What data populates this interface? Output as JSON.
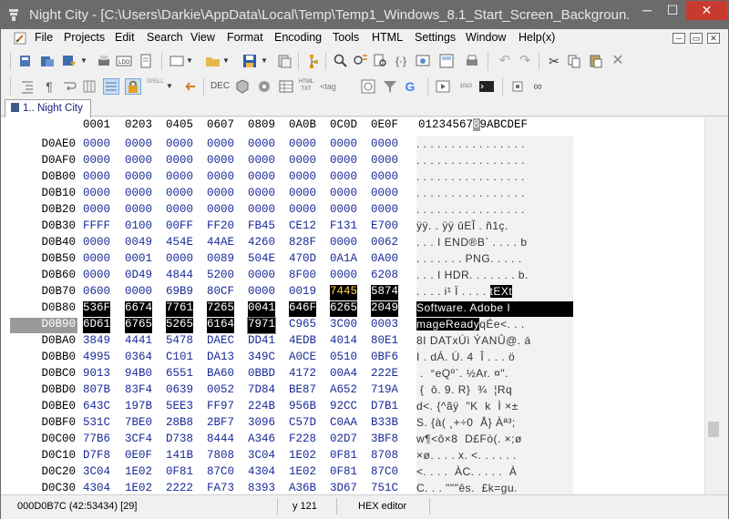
{
  "window": {
    "title": "Night City - [C:\\Users\\Darkie\\AppData\\Local\\Temp\\Temp1_Windows_8.1_Start_Screen_Backgroun...",
    "minimize": "─",
    "maximize": "☐",
    "close": "✕"
  },
  "menu": {
    "items": [
      "File",
      "Projects",
      "Edit",
      "Search",
      "View",
      "Format",
      "Encoding",
      "Tools",
      "HTML",
      "Settings",
      "Window",
      "Help(x)"
    ],
    "mdi_minimize": "─",
    "mdi_restore": "▭",
    "mdi_close": "✕"
  },
  "toolbar1": {
    "icons": [
      "new-project-icon",
      "open-project-icon",
      "save-project-icon",
      "print-icon",
      "ldd-icon",
      "page-icon",
      "new-file-icon",
      "open-folder-icon",
      "save-icon",
      "save-all-icon",
      "tree-icon",
      "find-icon",
      "replace-icon",
      "find-in-files-icon",
      "brackets-icon",
      "preview-icon",
      "print-doc-icon",
      "undo-icon",
      "redo-icon",
      "cut-icon",
      "copy-icon",
      "paste-icon",
      "delete-icon"
    ]
  },
  "toolbar2": {
    "icons": [
      "indent-icon",
      "pilcrow-icon",
      "wrap-icon",
      "column-mode-icon",
      "lock-icon",
      "spell-icon",
      "arrow-icon",
      "dec-icon",
      "cube-icon",
      "wheel-icon",
      "table-icon",
      "html-txt-icon",
      "tag-icon",
      "link-icon",
      "grid-icon",
      "filter-icon",
      "google-icon",
      "play-icon",
      "binary-icon",
      "cmd-icon",
      "stop-icon",
      "glasses-icon"
    ],
    "spell_label": "SPELL",
    "html_label": "HTML",
    "txt_label": "TXT",
    "bin_label": "1010",
    "tag_label": "<tag"
  },
  "tab": {
    "label": "1.. Night City"
  },
  "hex": {
    "header_cols": [
      "0001",
      "0203",
      "0405",
      "0607",
      "0809",
      "0A0B",
      "0C0D",
      "0E0F"
    ],
    "header_ascii_pre": "01234567",
    "header_ascii_caret": "8",
    "header_ascii_post": "9ABCDEF",
    "rows": [
      {
        "addr": "D0AE0",
        "cells": [
          "0000",
          "0000",
          "0000",
          "0000",
          "0000",
          "0000",
          "0000",
          "0000"
        ],
        "ascii": ". . . . . . . . . . . . . . . ."
      },
      {
        "addr": "D0AF0",
        "cells": [
          "0000",
          "0000",
          "0000",
          "0000",
          "0000",
          "0000",
          "0000",
          "0000"
        ],
        "ascii": ". . . . . . . . . . . . . . . ."
      },
      {
        "addr": "D0B00",
        "cells": [
          "0000",
          "0000",
          "0000",
          "0000",
          "0000",
          "0000",
          "0000",
          "0000"
        ],
        "ascii": ". . . . . . . . . . . . . . . ."
      },
      {
        "addr": "D0B10",
        "cells": [
          "0000",
          "0000",
          "0000",
          "0000",
          "0000",
          "0000",
          "0000",
          "0000"
        ],
        "ascii": ". . . . . . . . . . . . . . . ."
      },
      {
        "addr": "D0B20",
        "cells": [
          "0000",
          "0000",
          "0000",
          "0000",
          "0000",
          "0000",
          "0000",
          "0000"
        ],
        "ascii": ". . . . . . . . . . . . . . . ."
      },
      {
        "addr": "D0B30",
        "cells": [
          "FFFF",
          "0100",
          "00FF",
          "FF20",
          "FB45",
          "CE12",
          "F131",
          "E700"
        ],
        "ascii": "ÿÿ. . ÿÿ ûEÎ . ñ1ç."
      },
      {
        "addr": "D0B40",
        "cells": [
          "0000",
          "0049",
          "454E",
          "44AE",
          "4260",
          "828F",
          "0000",
          "0062"
        ],
        "ascii": ". . . I END®B` . . . . b"
      },
      {
        "addr": "D0B50",
        "cells": [
          "0000",
          "0001",
          "0000",
          "0089",
          "504E",
          "470D",
          "0A1A",
          "0A00"
        ],
        "ascii": ". . . . . . . PNG. . . . ."
      },
      {
        "addr": "D0B60",
        "cells": [
          "0000",
          "0D49",
          "4844",
          "5200",
          "0000",
          "8F00",
          "0000",
          "6208"
        ],
        "ascii": ". . . I HDR. . . . . . . b."
      },
      {
        "addr": "D0B70",
        "cells": [
          "0600",
          "0000",
          "69B9",
          "80CF",
          "0000",
          "0019",
          "7445",
          "5874"
        ],
        "ascii_pre": ". . . . i¹ Ï . . . . ",
        "ascii_sel": "tEXt",
        "ascii": ""
      },
      {
        "addr": "D0B80",
        "cells": [
          "536F",
          "6674",
          "7761",
          "7265",
          "0041",
          "646F",
          "6265",
          "2049"
        ],
        "ascii": "Software. Adobe I"
      },
      {
        "addr": "D0B90",
        "cells": [
          "6D61",
          "6765",
          "5265",
          "6164",
          "7971",
          "C965",
          "3C00",
          "0003"
        ],
        "ascii_sel": "mageReady",
        "ascii_post": "qÉe<. . ."
      },
      {
        "addr": "D0BA0",
        "cells": [
          "3849",
          "4441",
          "5478",
          "DAEC",
          "DD41",
          "4EDB",
          "4014",
          "80E1"
        ],
        "ascii": "8I DATxÚì ÝANÛ@. á"
      },
      {
        "addr": "D0BB0",
        "cells": [
          "4995",
          "0364",
          "C101",
          "DA13",
          "349C",
          "A0CE",
          "0510",
          "0BF6"
        ],
        "ascii": "I . dÁ. Ú. 4  Î . . . ö"
      },
      {
        "addr": "D0BC0",
        "cells": [
          "9013",
          "94B0",
          "6551",
          "BA60",
          "0BBD",
          "4172",
          "00A4",
          "222E"
        ],
        "ascii": " .  °eQº`. ½Ar. ¤\"."
      },
      {
        "addr": "D0BD0",
        "cells": [
          "807B",
          "83F4",
          "0639",
          "0052",
          "7D84",
          "BE87",
          "A652",
          "719A"
        ],
        "ascii": " {  ô. 9. R}  ¾  ¦Rq"
      },
      {
        "addr": "D0BE0",
        "cells": [
          "643C",
          "197B",
          "5EE3",
          "FF97",
          "224B",
          "956B",
          "92CC",
          "D7B1"
        ],
        "ascii": "d<. {^ãÿ  \"K  k  Ì ×±"
      },
      {
        "addr": "D0BF0",
        "cells": [
          "531C",
          "7BE0",
          "28B8",
          "2BF7",
          "3096",
          "C57D",
          "C0AA",
          "B33B"
        ],
        "ascii": "S. {à( ¸+÷0  Å} Àª³;"
      },
      {
        "addr": "D0C00",
        "cells": [
          "77B6",
          "3CF4",
          "D738",
          "8444",
          "A346",
          "F228",
          "02D7",
          "3BF8"
        ],
        "ascii": "w¶<ô×8  D£Fò(. ×;ø"
      },
      {
        "addr": "D0C10",
        "cells": [
          "D7F8",
          "0E0F",
          "141B",
          "7808",
          "3C04",
          "1E02",
          "0F81",
          "8708"
        ],
        "ascii": "×ø. . . . x. <. . . . . ."
      },
      {
        "addr": "D0C20",
        "cells": [
          "3C04",
          "1E02",
          "0F81",
          "87C0",
          "4304",
          "1E02",
          "0F81",
          "87C0"
        ],
        "ascii": "<. . . .  ÀC. . . . .  À"
      },
      {
        "addr": "D0C30",
        "cells": [
          "4304",
          "1E02",
          "2222",
          "FA73",
          "8393",
          "A36B",
          "3D67",
          "751C"
        ],
        "ascii": "C. . . \"\"\"ês.  £k=gu."
      }
    ]
  },
  "status": {
    "position": "000D0B7C  (42:53434)  [29]",
    "line": "y  121",
    "mode": "HEX editor"
  }
}
